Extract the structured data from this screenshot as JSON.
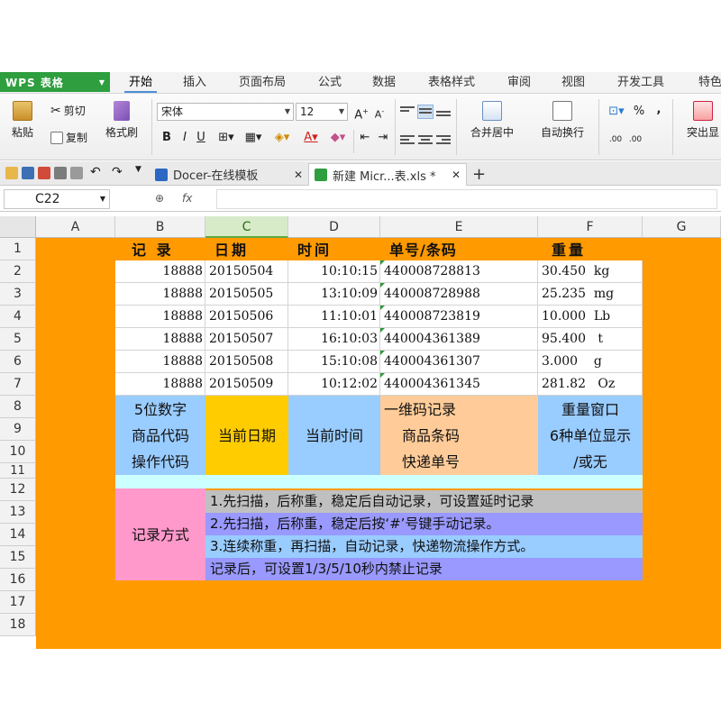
{
  "app": {
    "name": "WPS 表格"
  },
  "menu": [
    "开始",
    "插入",
    "页面布局",
    "公式",
    "数据",
    "表格样式",
    "审阅",
    "视图",
    "开发工具",
    "特色"
  ],
  "ribbon": {
    "paste": "粘贴",
    "cut": "剪切",
    "copy": "复制",
    "format_painter": "格式刷",
    "font_name": "宋体",
    "font_size": "12",
    "grow": "A",
    "shrink": "A",
    "bold": "B",
    "italic": "I",
    "underline": "U",
    "merge_center": "合并居中",
    "wrap_text": "自动换行",
    "percent": "%",
    "comma": ",",
    "dec_inc": ".00",
    "dec_dec": ".00",
    "highlight": "突出显"
  },
  "tabs": [
    {
      "label": "Docer-在线模板"
    },
    {
      "label": "新建 Micr...表.xls *"
    }
  ],
  "formula_bar": {
    "name_box": "C22",
    "fx": "fx"
  },
  "columns": [
    "A",
    "B",
    "C",
    "D",
    "E",
    "F",
    "G"
  ],
  "rows": [
    "1",
    "2",
    "3",
    "4",
    "5",
    "6",
    "7",
    "8",
    "9",
    "10",
    "11",
    "12",
    "13",
    "14",
    "15",
    "16",
    "17",
    "18"
  ],
  "headers": {
    "record": "记 录",
    "date": "日期",
    "time": "时间",
    "barcode": "单号/条码",
    "weight": "重量"
  },
  "records": [
    {
      "code": "18888",
      "date": "20150504",
      "time": "10:10:15",
      "barcode": "440008728813",
      "weight": "30.450  kg"
    },
    {
      "code": "18888",
      "date": "20150505",
      "time": "13:10:09",
      "barcode": "440008728988",
      "weight": "25.235  mg"
    },
    {
      "code": "18888",
      "date": "20150506",
      "time": "11:10:01",
      "barcode": "440008723819",
      "weight": "10.000  Lb"
    },
    {
      "code": "18888",
      "date": "20150507",
      "time": "16:10:03",
      "barcode": "440004361389",
      "weight": "95.400   t"
    },
    {
      "code": "18888",
      "date": "20150508",
      "time": "15:10:08",
      "barcode": "440004361307",
      "weight": "3.000    g"
    },
    {
      "code": "18888",
      "date": "20150509",
      "time": "10:12:02",
      "barcode": "440004361345",
      "weight": "281.82   Oz"
    }
  ],
  "desc": {
    "code": [
      "5位数字",
      "商品代码",
      "操作代码"
    ],
    "date": "当前日期",
    "time": "当前时间",
    "barcode": [
      "一维码记录",
      "商品条码",
      "快递单号"
    ],
    "weight": [
      "重量窗口",
      "6种单位显示",
      "/或无"
    ]
  },
  "method": {
    "label": "记录方式",
    "lines": [
      "1.先扫描，后称重，稳定后自动记录，可设置延时记录",
      "2.先扫描，后称重，稳定后按‘#’号键手动记录。",
      "3.连续称重，再扫描，自动记录，快递物流操作方式。",
      "记录后，可设置1/3/5/10秒内禁止记录"
    ]
  },
  "colors": {
    "sheet_bg": "#ff9a00",
    "blue": "#99ccff",
    "yellow": "#ffcc00",
    "peach": "#ffcc99",
    "light_cyan": "#ccffff",
    "pink": "#ff99cc",
    "gray_line": "#c0c0c0",
    "purple_line": "#9999ff",
    "wps_green": "#2e9e3e"
  }
}
